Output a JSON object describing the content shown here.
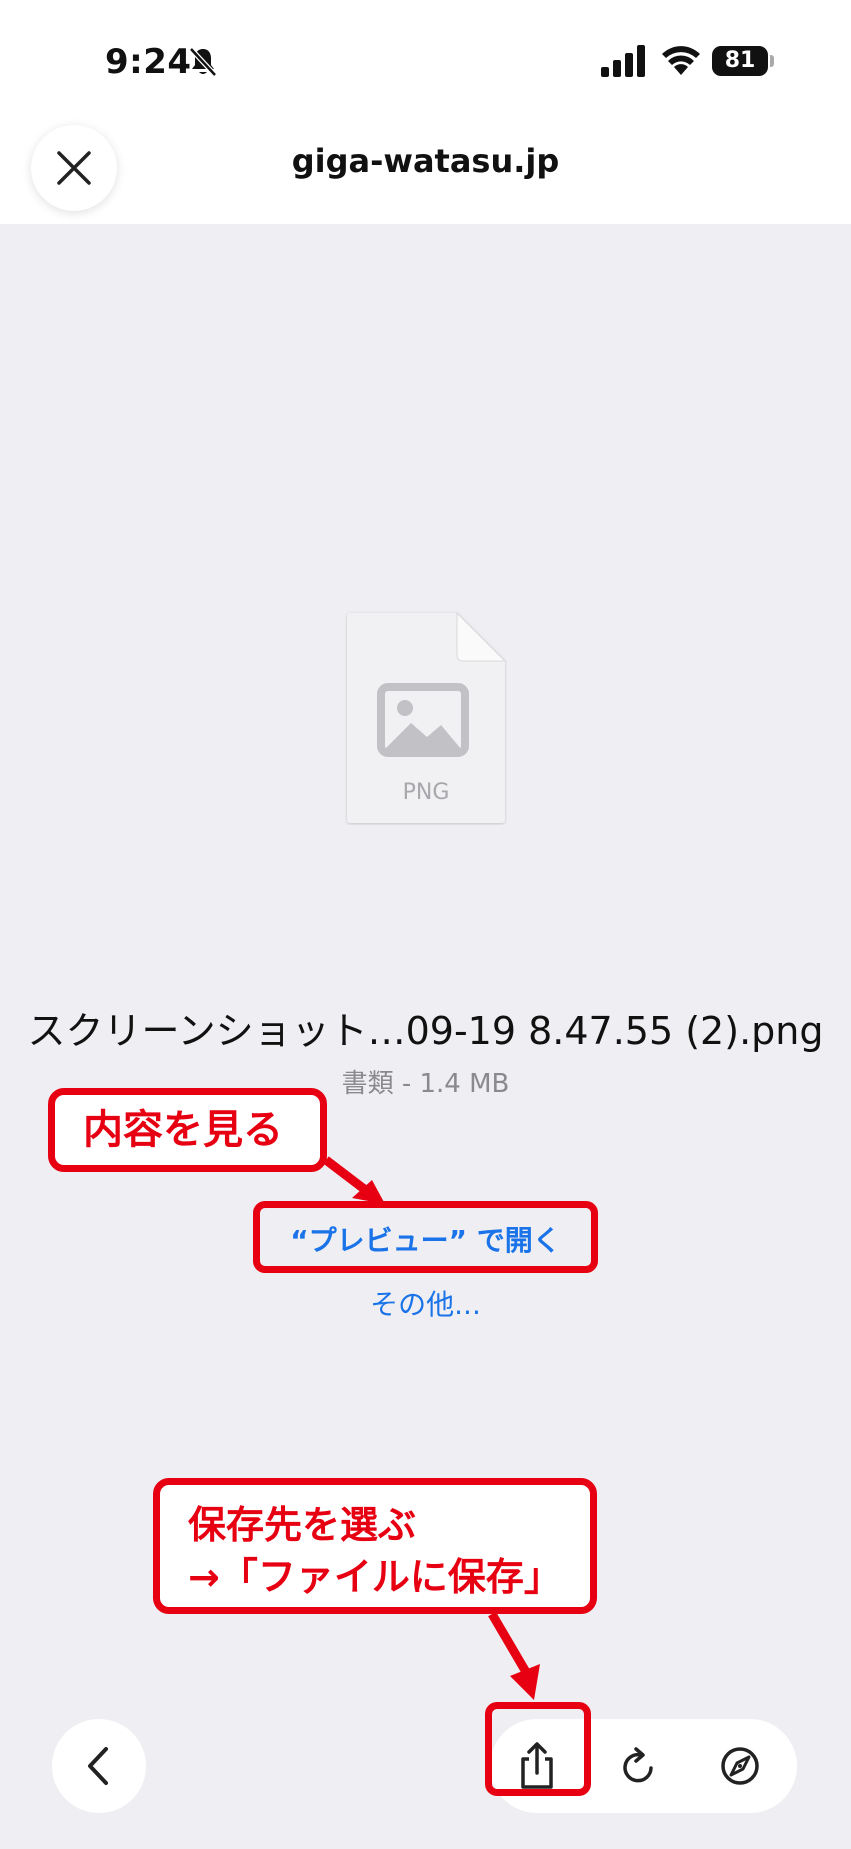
{
  "status_bar": {
    "time": "9:24",
    "battery": "81"
  },
  "top_bar": {
    "domain": "giga-watasu.jp"
  },
  "file": {
    "type_label": "PNG",
    "name": "スクリーンショット…09-19 8.47.55 (2).png",
    "meta": "書類 - 1.4 MB"
  },
  "actions": {
    "open_preview": "“プレビュー” で開く",
    "more": "その他..."
  },
  "annotations": {
    "view_content": "内容を見る",
    "save_line1": "保存先を選ぶ",
    "save_line2": "→「ファイルに保存」"
  },
  "colors": {
    "accent": "#1a73e8",
    "annotation": "#e60012"
  }
}
